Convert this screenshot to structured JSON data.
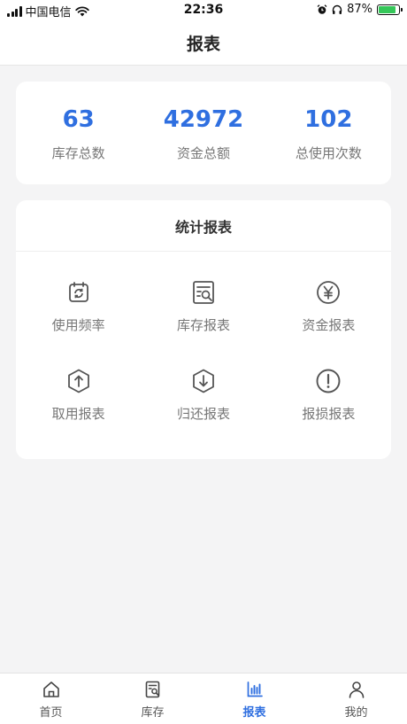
{
  "status_bar": {
    "carrier": "中国电信",
    "time": "22:36",
    "battery": "87%",
    "battery_level": 0.87,
    "icons": [
      "signal-icon",
      "wifi-icon",
      "alarm-icon",
      "headphones-icon",
      "battery-icon"
    ]
  },
  "header": {
    "title": "报表"
  },
  "summary": [
    {
      "value": "63",
      "label": "库存总数"
    },
    {
      "value": "42972",
      "label": "资金总额"
    },
    {
      "value": "102",
      "label": "总使用次数"
    }
  ],
  "reports": {
    "title": "统计报表",
    "items": [
      {
        "label": "使用频率",
        "icon": "usage-frequency-icon"
      },
      {
        "label": "库存报表",
        "icon": "inventory-report-icon"
      },
      {
        "label": "资金报表",
        "icon": "yen-icon"
      },
      {
        "label": "取用报表",
        "icon": "take-out-icon"
      },
      {
        "label": "归还报表",
        "icon": "return-icon"
      },
      {
        "label": "报损报表",
        "icon": "damage-alert-icon"
      }
    ]
  },
  "tabbar": {
    "active": "报表",
    "accent_color": "#2f6fe0",
    "items": [
      {
        "label": "首页",
        "icon": "home-icon"
      },
      {
        "label": "库存",
        "icon": "inventory-icon"
      },
      {
        "label": "报表",
        "icon": "bar-chart-icon"
      },
      {
        "label": "我的",
        "icon": "user-icon"
      }
    ]
  }
}
